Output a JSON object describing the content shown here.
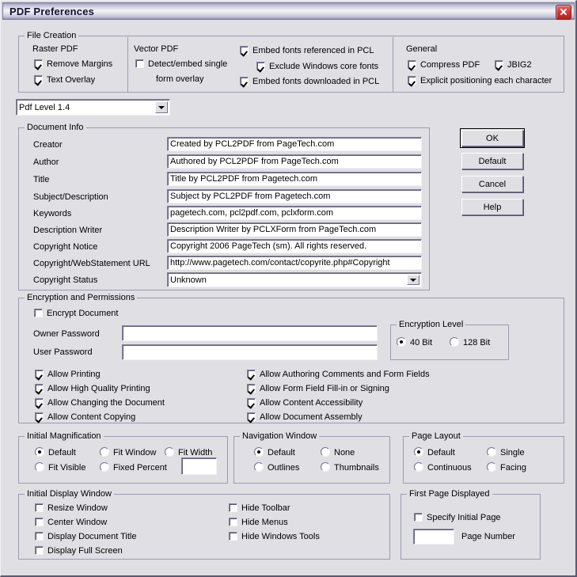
{
  "window": {
    "title": "PDF Preferences",
    "close_icon": "close-icon"
  },
  "file_creation": {
    "legend": "File Creation",
    "raster_label": "Raster PDF",
    "vector_label": "Vector PDF",
    "general_label": "General",
    "checkboxes": [
      {
        "label": "Remove Margins",
        "checked": true
      },
      {
        "label": "Text Overlay",
        "checked": true
      },
      {
        "label": "Detect/embed single",
        "checked": false
      },
      {
        "label": "form overlay",
        "checked": false
      },
      {
        "label": "Embed fonts referenced in PCL",
        "checked": true
      },
      {
        "label": "Exclude Windows core fonts",
        "checked": true
      },
      {
        "label": "Embed fonts downloaded in PCL",
        "checked": true
      },
      {
        "label": "Compress PDF",
        "checked": true
      },
      {
        "label": "JBIG2",
        "checked": true
      },
      {
        "label": "Explicit positioning each character",
        "checked": true
      }
    ]
  },
  "pdf_level": {
    "value": "Pdf Level 1.4"
  },
  "document_info": {
    "legend": "Document Info",
    "fields": [
      {
        "label": "Creator",
        "value": "Created by PCL2PDF from PageTech.com"
      },
      {
        "label": "Author",
        "value": "Authored by PCL2PDF from PageTech.com"
      },
      {
        "label": "Title",
        "value": "Title by PCL2PDF from Pagetech.com"
      },
      {
        "label": "Subject/Description",
        "value": "Subject by PCL2PDF from Pagetech.com"
      },
      {
        "label": "Keywords",
        "value": "pagetech.com, pcl2pdf.com, pclxform.com"
      },
      {
        "label": "Description Writer",
        "value": "Description Writer by PCLXForm from PageTech.com"
      },
      {
        "label": "Copyright Notice",
        "value": "Copyright 2006 PageTech (sm).  All rights reserved."
      },
      {
        "label": "Copyright/WebStatement URL",
        "value": "http://www.pagetech.com/contact/copyrite.php#Copyright"
      }
    ],
    "status_label": "Copyright Status",
    "status_value": "Unknown"
  },
  "buttons": {
    "ok": "OK",
    "default": "Default",
    "cancel": "Cancel",
    "help": "Help"
  },
  "encryption": {
    "legend": "Encryption and Permissions",
    "encrypt_document": {
      "label": "Encrypt Document",
      "checked": false
    },
    "owner_password_label": "Owner Password",
    "owner_password_value": "",
    "user_password_label": "User Password",
    "user_password_value": "",
    "level_legend": "Encryption Level",
    "level_options": [
      {
        "label": "40 Bit",
        "selected": true
      },
      {
        "label": "128 Bit",
        "selected": false
      }
    ],
    "permissions_left": [
      {
        "label": "Allow Printing",
        "checked": true
      },
      {
        "label": "Allow High Quality Printing",
        "checked": true
      },
      {
        "label": "Allow Changing the Document",
        "checked": true
      },
      {
        "label": "Allow Content Copying",
        "checked": true
      }
    ],
    "permissions_right": [
      {
        "label": "Allow Authoring Comments and Form Fields",
        "checked": true
      },
      {
        "label": "Allow Form Field Fill-in or Signing",
        "checked": true
      },
      {
        "label": "Allow Content Accessibility",
        "checked": true
      },
      {
        "label": "Allow Document Assembly",
        "checked": true
      }
    ]
  },
  "initial_magnification": {
    "legend": "Initial Magnification",
    "options": [
      {
        "label": "Default",
        "selected": true
      },
      {
        "label": "Fit Window",
        "selected": false
      },
      {
        "label": "Fit Width",
        "selected": false
      },
      {
        "label": "Fit Visible",
        "selected": false
      },
      {
        "label": "Fixed Percent",
        "selected": false
      }
    ],
    "percent_value": ""
  },
  "navigation_window": {
    "legend": "Navigation Window",
    "options": [
      {
        "label": "Default",
        "selected": true
      },
      {
        "label": "None",
        "selected": false
      },
      {
        "label": "Outlines",
        "selected": false
      },
      {
        "label": "Thumbnails",
        "selected": false
      }
    ]
  },
  "page_layout": {
    "legend": "Page Layout",
    "options": [
      {
        "label": "Default",
        "selected": true
      },
      {
        "label": "Single",
        "selected": false
      },
      {
        "label": "Continuous",
        "selected": false
      },
      {
        "label": "Facing",
        "selected": false
      }
    ]
  },
  "initial_display_window": {
    "legend": "Initial Display Window",
    "left": [
      {
        "label": "Resize Window",
        "checked": false
      },
      {
        "label": "Center Window",
        "checked": false
      },
      {
        "label": "Display Document Title",
        "checked": false
      },
      {
        "label": "Display Full Screen",
        "checked": false
      }
    ],
    "right": [
      {
        "label": "Hide Toolbar",
        "checked": false
      },
      {
        "label": "Hide Menus",
        "checked": false
      },
      {
        "label": "Hide Windows Tools",
        "checked": false
      }
    ]
  },
  "first_page_displayed": {
    "legend": "First Page Displayed",
    "specify": {
      "label": "Specify Initial Page",
      "checked": false
    },
    "page_number_value": "",
    "page_number_label": "Page Number"
  }
}
